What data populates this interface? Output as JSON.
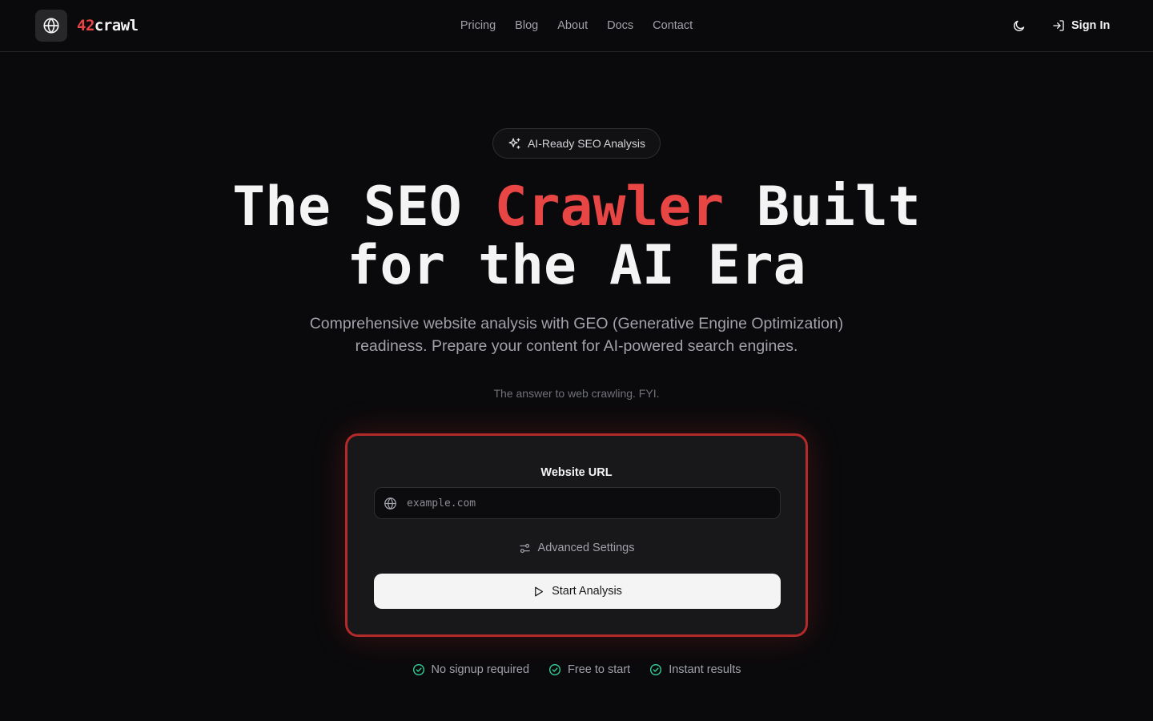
{
  "brand": {
    "number": "42",
    "word": "crawl"
  },
  "nav": {
    "items": [
      {
        "label": "Pricing"
      },
      {
        "label": "Blog"
      },
      {
        "label": "About"
      },
      {
        "label": "Docs"
      },
      {
        "label": "Contact"
      }
    ],
    "sign_in": "Sign In",
    "theme_icon": "moon-icon"
  },
  "hero": {
    "badge": "AI-Ready SEO Analysis",
    "headline": {
      "part1": "The SEO ",
      "accent": "Crawler",
      "part2": " Built",
      "line2": "for the AI Era"
    },
    "subhead": "Comprehensive website analysis with GEO (Generative Engine Optimization) readiness. Prepare your content for AI-powered search engines.",
    "tagline": "The answer to web crawling. FYI."
  },
  "form": {
    "url_label": "Website URL",
    "url_value": "",
    "url_placeholder": "example.com",
    "advanced_label": "Advanced Settings",
    "submit_label": "Start Analysis"
  },
  "features": [
    {
      "label": "No signup required"
    },
    {
      "label": "Free to start"
    },
    {
      "label": "Instant results"
    }
  ],
  "colors": {
    "accent": "#e84545",
    "background": "#0a0a0c",
    "card_border": "#b32a2a",
    "check": "#34d399"
  }
}
